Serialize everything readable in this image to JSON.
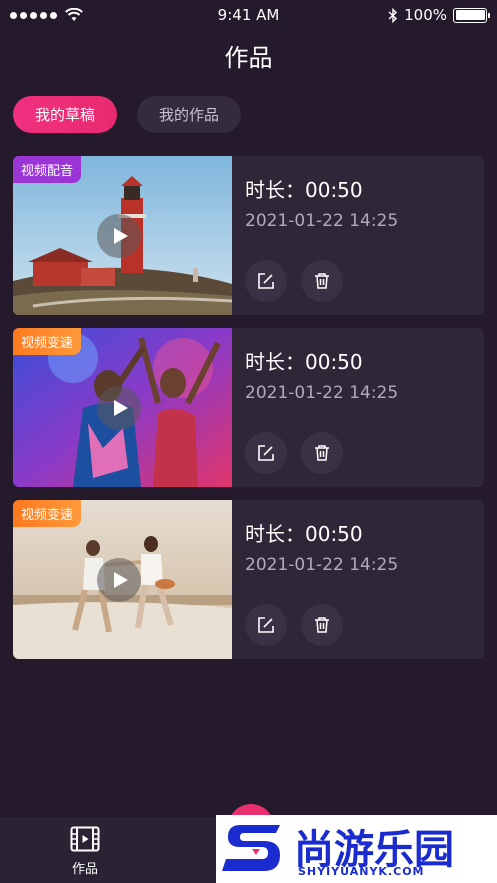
{
  "status_bar": {
    "time": "9:41 AM",
    "battery": "100%"
  },
  "header": {
    "title": "作品"
  },
  "tabs": [
    {
      "label": "我的草稿",
      "active": true
    },
    {
      "label": "我的作品",
      "active": false
    }
  ],
  "works": [
    {
      "badge": "视频配音",
      "badge_color": "#9c35d6",
      "duration": "时长：00:50",
      "date": "2021-01-22 14:25",
      "scene": "lighthouse"
    },
    {
      "badge": "视频变速",
      "badge_color": "#ff8a2a",
      "duration": "时长：00:50",
      "date": "2021-01-22 14:25",
      "scene": "party"
    },
    {
      "badge": "视频变速",
      "badge_color": "#ff8a2a",
      "duration": "时长：00:50",
      "date": "2021-01-22 14:25",
      "scene": "beach"
    }
  ],
  "bottom_nav": {
    "works_label": "作品"
  },
  "watermark": {
    "text": "尚游乐园",
    "sub": "SHYIYUANYK.COM"
  },
  "colors": {
    "background": "#241a2c",
    "card": "#2f2637",
    "accent": "#e8306f"
  }
}
